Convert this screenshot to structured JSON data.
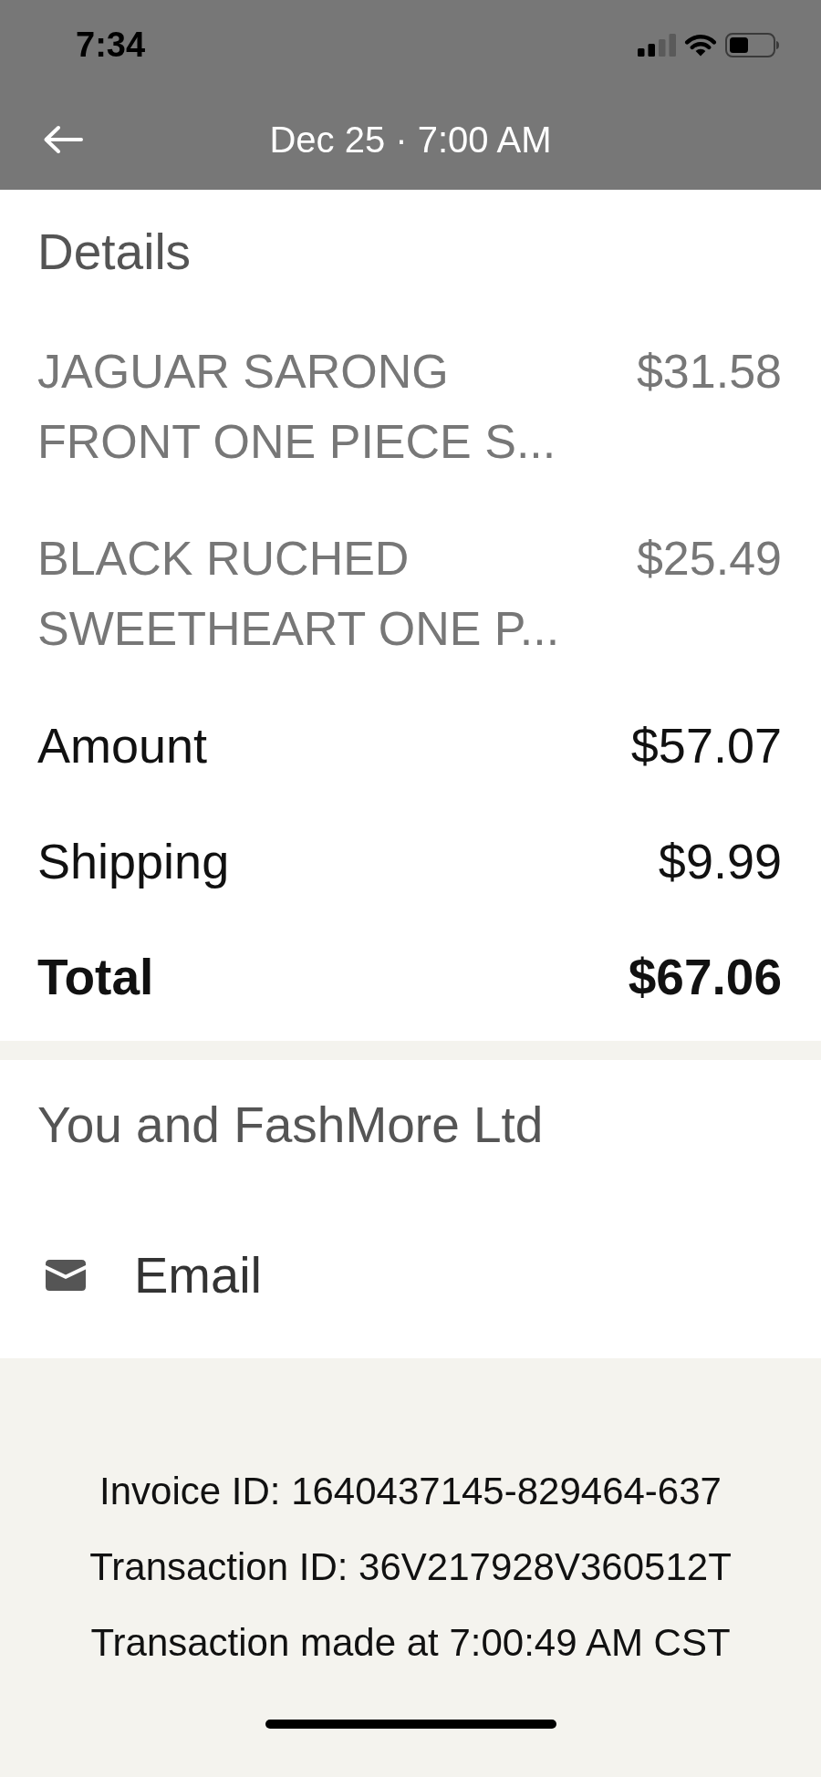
{
  "status_bar": {
    "time": "7:34"
  },
  "nav": {
    "title": "Dec 25 · 7:00 AM"
  },
  "details": {
    "heading": "Details",
    "items": [
      {
        "name": "JAGUAR SARONG FRONT ONE PIECE S...",
        "price": "$31.58"
      },
      {
        "name": "BLACK RUCHED SWEETHEART ONE P...",
        "price": "$25.49"
      }
    ],
    "summary": [
      {
        "kind": "regular",
        "label": "Amount",
        "value": "$57.07"
      },
      {
        "kind": "regular",
        "label": "Shipping",
        "value": "$9.99"
      },
      {
        "kind": "total",
        "label": "Total",
        "value": "$67.06"
      }
    ]
  },
  "counterparty": {
    "heading": "You and FashMore Ltd",
    "contacts": [
      {
        "kind": "email",
        "label": "Email"
      }
    ]
  },
  "footer": {
    "lines": [
      "Invoice ID: 1640437145-829464-637",
      "Transaction ID: 36V217928V360512T",
      "Transaction made at 7:00:49 AM CST"
    ]
  }
}
